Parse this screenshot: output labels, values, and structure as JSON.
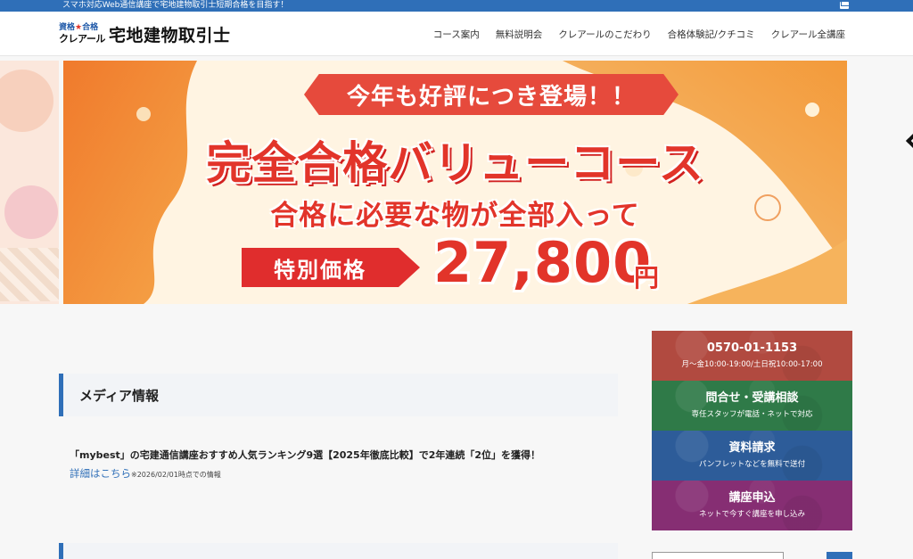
{
  "topbar": {
    "text": "スマホ対応Web通信講座で宅地建物取引士短期合格を目指す！",
    "mail_icon": "mail-icon"
  },
  "header": {
    "logo_line1": "資格",
    "logo_star": "★",
    "logo_line1b": "合格",
    "logo_line2": "クレアール",
    "site_title": "宅地建物取引士",
    "nav": [
      {
        "label": "コース案内"
      },
      {
        "label": "無料説明会"
      },
      {
        "label": "クレアールのこだわり"
      },
      {
        "label": "合格体験記/クチコミ"
      },
      {
        "label": "クレアール全講座"
      }
    ]
  },
  "hero": {
    "ribbon": "今年も好評につき登場！！",
    "main": "完全合格バリューコース",
    "sub": "合格に必要な物が全部入って",
    "price_label": "特別価格",
    "price": "27,800",
    "yen": "円"
  },
  "media": {
    "heading": "メディア情報",
    "text": "「mybest」の宅建通信講座おすすめ人気ランキング9選【2025年徹底比較】で2年連続「2位」を獲得！",
    "link": "詳細はこちら",
    "note": "※2026/02/01時点での情報"
  },
  "sidebar": {
    "tel": {
      "title": "0570-01-1153",
      "desc": "月～金10:00-19:00/土日祝10:00-17:00"
    },
    "consult": {
      "title": "問合せ・受講相談",
      "desc": "専任スタッフが電話・ネットで対応"
    },
    "docs": {
      "title": "資料請求",
      "desc": "パンフレットなどを無料で送付"
    },
    "apply": {
      "title": "講座申込",
      "desc": "ネットで今すぐ講座を申し込み"
    }
  },
  "colors": {
    "accent": "#2f6fb8",
    "hero_red": "#e2342a",
    "tel": "#b14a40",
    "consult": "#2f7a48",
    "docs": "#2d5c99",
    "apply": "#862e73"
  }
}
